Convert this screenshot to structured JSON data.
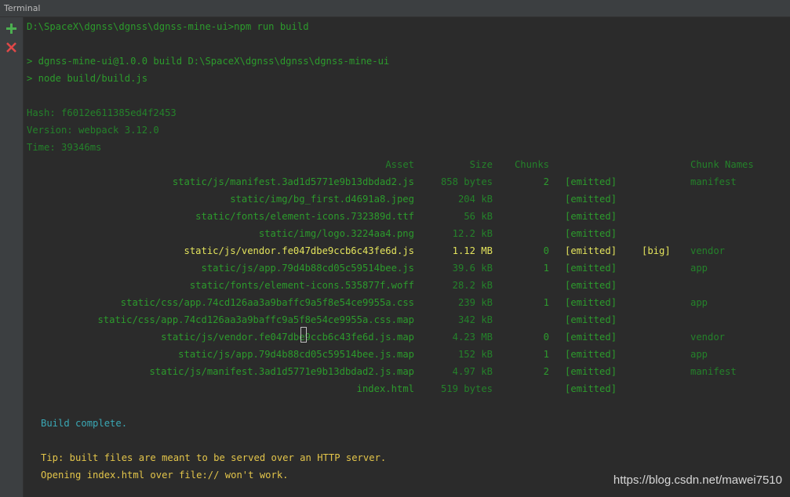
{
  "window": {
    "title": "Terminal"
  },
  "sidebar": {
    "buttons": [
      {
        "name": "new-session-button",
        "icon": "plus-icon",
        "color": "#4caf50"
      },
      {
        "name": "close-session-button",
        "icon": "close-icon",
        "color": "#e04848"
      }
    ]
  },
  "terminal": {
    "command_line": "D:\\SpaceX\\dgnss\\dgnss\\dgnss-mine-ui>npm run build",
    "npm_lines": [
      "> dgnss-mine-ui@1.0.0 build D:\\SpaceX\\dgnss\\dgnss\\dgnss-mine-ui",
      "> node build/build.js"
    ],
    "stats": [
      "Hash: f6012e611385ed4f2453",
      "Version: webpack 3.12.0",
      "Time: 39346ms"
    ],
    "table_header": {
      "asset": "Asset",
      "size": "Size",
      "chunks": "Chunks",
      "chunk_names": "Chunk Names"
    },
    "assets": [
      {
        "asset": "static/js/manifest.3ad1d5771e9b13dbdad2.js",
        "size": "858 bytes",
        "chunks": "2",
        "status": "[emitted]",
        "flag": "",
        "chunk_names": "manifest",
        "big": false
      },
      {
        "asset": "static/img/bg_first.d4691a8.jpeg",
        "size": "204 kB",
        "chunks": "",
        "status": "[emitted]",
        "flag": "",
        "chunk_names": "",
        "big": false
      },
      {
        "asset": "static/fonts/element-icons.732389d.ttf",
        "size": "56 kB",
        "chunks": "",
        "status": "[emitted]",
        "flag": "",
        "chunk_names": "",
        "big": false
      },
      {
        "asset": "static/img/logo.3224aa4.png",
        "size": "12.2 kB",
        "chunks": "",
        "status": "[emitted]",
        "flag": "",
        "chunk_names": "",
        "big": false
      },
      {
        "asset": "static/js/vendor.fe047dbe9ccb6c43fe6d.js",
        "size": "1.12 MB",
        "chunks": "0",
        "status": "[emitted]",
        "flag": "[big]",
        "chunk_names": "vendor",
        "big": true
      },
      {
        "asset": "static/js/app.79d4b88cd05c59514bee.js",
        "size": "39.6 kB",
        "chunks": "1",
        "status": "[emitted]",
        "flag": "",
        "chunk_names": "app",
        "big": false
      },
      {
        "asset": "static/fonts/element-icons.535877f.woff",
        "size": "28.2 kB",
        "chunks": "",
        "status": "[emitted]",
        "flag": "",
        "chunk_names": "",
        "big": false
      },
      {
        "asset": "static/css/app.74cd126aa3a9baffc9a5f8e54ce9955a.css",
        "size": "239 kB",
        "chunks": "1",
        "status": "[emitted]",
        "flag": "",
        "chunk_names": "app",
        "big": false
      },
      {
        "asset": "static/css/app.74cd126aa3a9baffc9a5f8e54ce9955a.css.map",
        "size": "342 kB",
        "chunks": "",
        "status": "[emitted]",
        "flag": "",
        "chunk_names": "",
        "big": false
      },
      {
        "asset": "static/js/vendor.fe047dbe9ccb6c43fe6d.js.map",
        "size": "4.23 MB",
        "chunks": "0",
        "status": "[emitted]",
        "flag": "",
        "chunk_names": "vendor",
        "big": false
      },
      {
        "asset": "static/js/app.79d4b88cd05c59514bee.js.map",
        "size": "152 kB",
        "chunks": "1",
        "status": "[emitted]",
        "flag": "",
        "chunk_names": "app",
        "big": false
      },
      {
        "asset": "static/js/manifest.3ad1d5771e9b13dbdad2.js.map",
        "size": "4.97 kB",
        "chunks": "2",
        "status": "[emitted]",
        "flag": "",
        "chunk_names": "manifest",
        "big": false
      },
      {
        "asset": "index.html",
        "size": "519 bytes",
        "chunks": "",
        "status": "[emitted]",
        "flag": "",
        "chunk_names": "",
        "big": false
      }
    ],
    "build_complete": "Build complete.",
    "tips": [
      "Tip: built files are meant to be served over an HTTP server.",
      "Opening index.html over file:// won't work."
    ]
  },
  "watermark": "https://blog.csdn.net/mawei7510",
  "colors": {
    "output_green": "#2c9b2c",
    "big_yellow": "#e3e35c",
    "build_cyan": "#3aa8b5",
    "tip_yellow": "#e3c54a"
  }
}
